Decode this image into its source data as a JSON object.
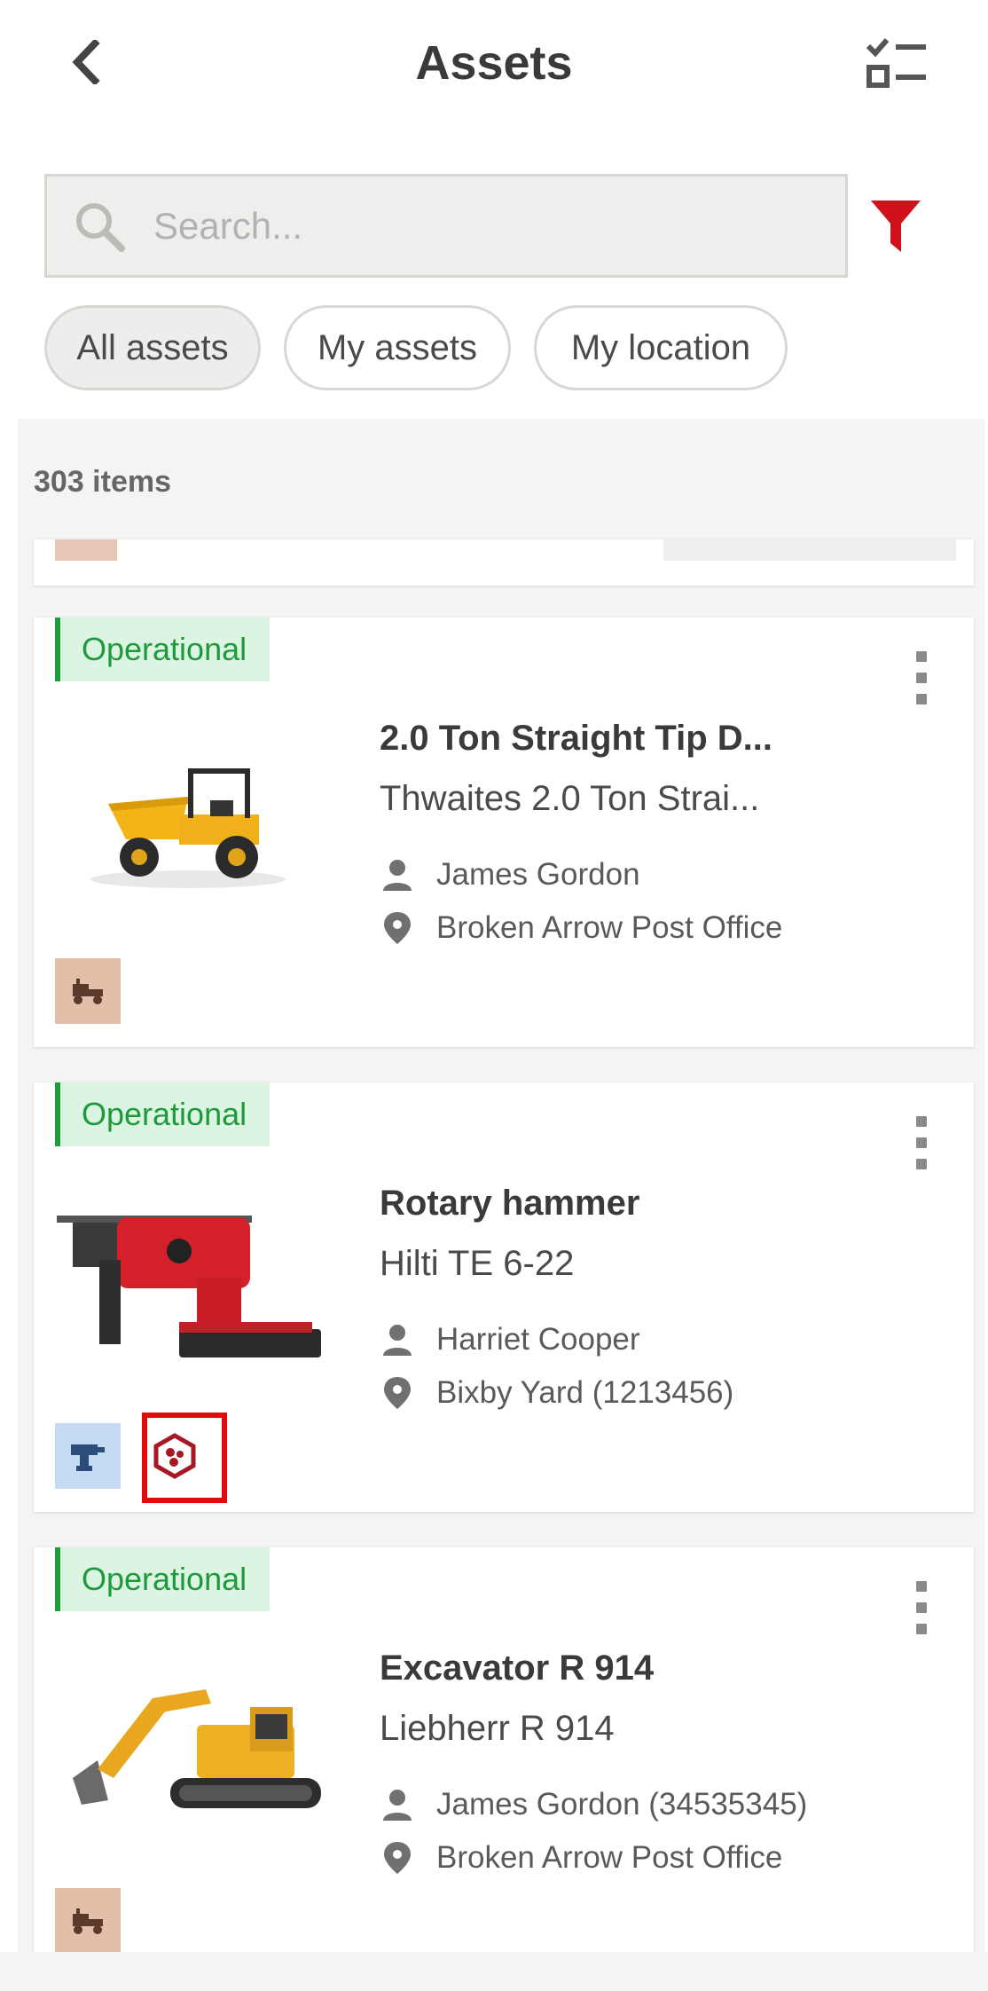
{
  "header": {
    "title": "Assets",
    "back_icon": "chevron-left-icon",
    "checklist_icon": "checklist-icon"
  },
  "search": {
    "placeholder": "Search...",
    "value": "",
    "filter_icon": "funnel-icon",
    "filter_color": "#d0101a"
  },
  "chips": [
    {
      "label": "All assets",
      "active": true
    },
    {
      "label": "My assets",
      "active": false
    },
    {
      "label": "My location",
      "active": false
    }
  ],
  "list": {
    "count_label": "303 items",
    "items": [
      {
        "status": "Operational",
        "title": "2.0 Ton Straight Tip D...",
        "model": "Thwaites 2.0 Ton Strai...",
        "person": "James Gordon",
        "location": "Broken Arrow Post Office",
        "image": "dumper-image",
        "category_icon": "machinery-icon"
      },
      {
        "status": "Operational",
        "title": "Rotary hammer",
        "model": "Hilti TE 6-22",
        "person": "Harriet Cooper",
        "location": "Bixby Yard (1213456)",
        "image": "rotary-hammer-image",
        "category_icon": "power-tool-icon",
        "tag_icon": "hexagon-tag-icon"
      },
      {
        "status": "Operational",
        "title": "Excavator R 914",
        "model": "Liebherr R 914",
        "person": "James Gordon (34535345)",
        "location": "Broken Arrow Post Office",
        "image": "excavator-image",
        "category_icon": "machinery-icon"
      }
    ]
  },
  "colors": {
    "status_green": "#1e9a3c",
    "status_bg": "#dcf5e2",
    "highlight_red": "#e00b0b"
  }
}
